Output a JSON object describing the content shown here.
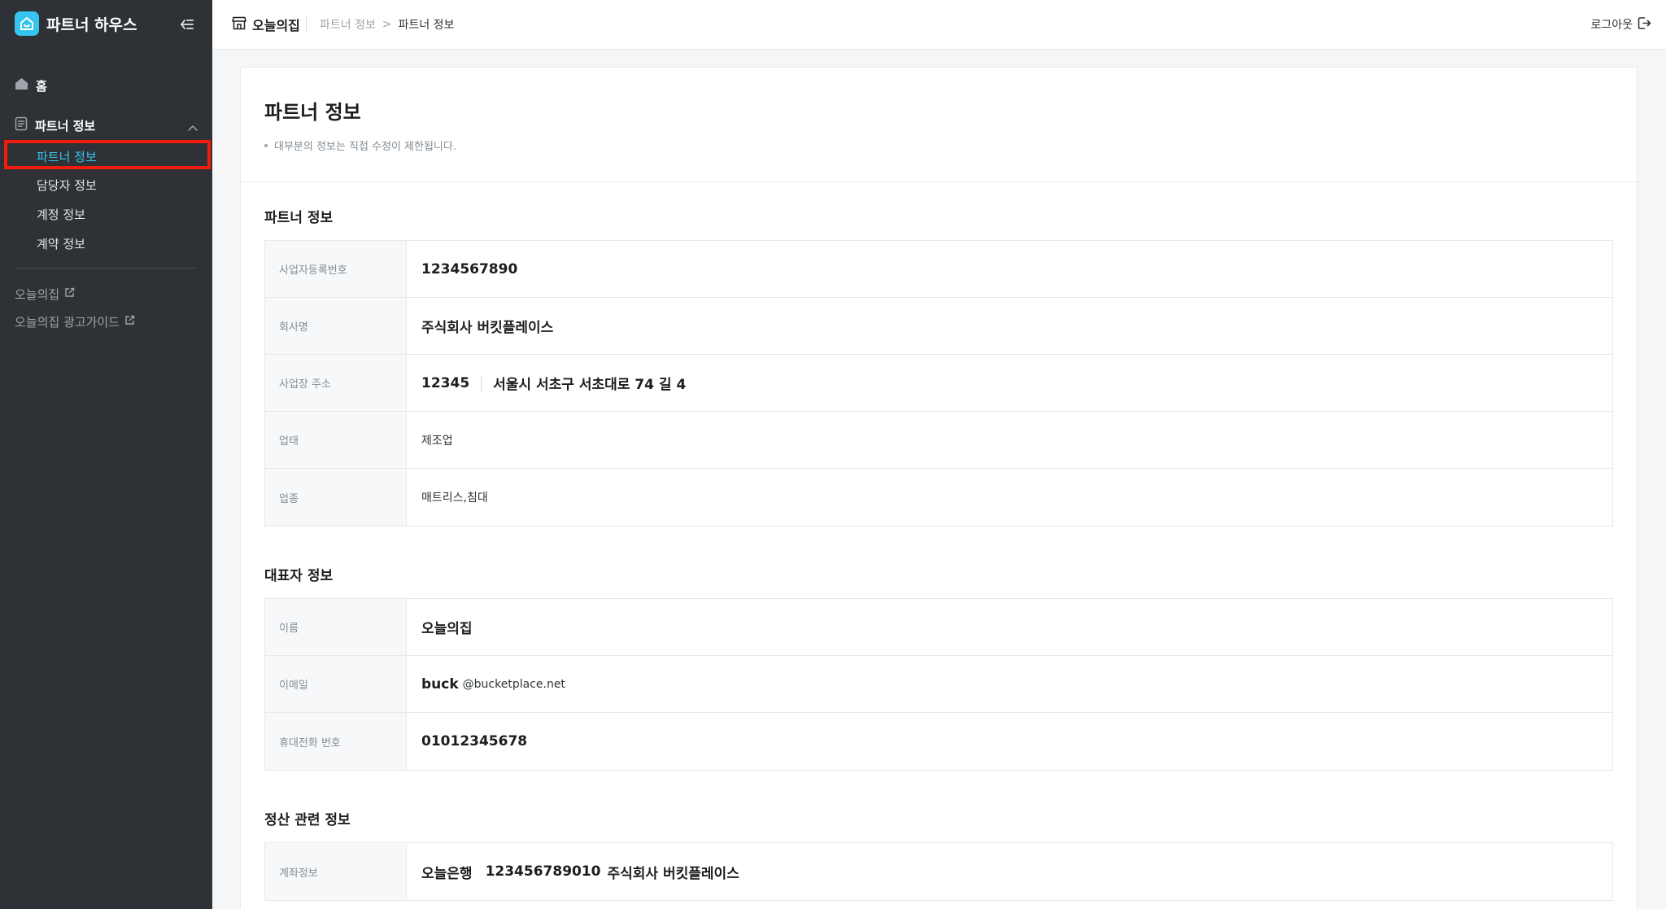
{
  "sidebar": {
    "brand": "파트너 하우스",
    "home": "홈",
    "group": "파트너 정보",
    "items": [
      "파트너 정보",
      "담당자 정보",
      "계정 정보",
      "계약 정보"
    ],
    "links": [
      "오늘의집",
      "오늘의집 광고가이드"
    ]
  },
  "topbar": {
    "shop": "오늘의집",
    "breadcrumb": [
      "파트너 정보",
      "파트너 정보"
    ],
    "logout": "로그아웃"
  },
  "page": {
    "title": "파트너 정보",
    "note": "대부분의 정보는 직접 수정이 제한됩니다."
  },
  "partner": {
    "title": "파트너 정보",
    "labels": [
      "사업자등록번호",
      "회사명",
      "사업장 주소",
      "업태",
      "업종"
    ],
    "business_number": "1234567890",
    "company": "주식회사 버킷플레이스",
    "zip": "12345",
    "address": "서울시 서초구 서초대로 74 길 4",
    "business_type": "제조업",
    "business_item": "매트리스,침대"
  },
  "representative": {
    "title": "대표자 정보",
    "labels": [
      "이름",
      "이메일",
      "휴대전화 번호"
    ],
    "name": "오늘의집",
    "email_id": "buck",
    "email_domain": "@bucketplace.net",
    "phone": "01012345678"
  },
  "settlement": {
    "title": "정산 관련 정보",
    "labels": [
      "계좌정보"
    ],
    "bank": "오늘은행",
    "account": "123456789010",
    "owner": "주식회사 버킷플레이스"
  },
  "colors": {
    "sidebar_bg": "#2e3236",
    "accent": "#35c5f0",
    "highlight": "#f11c0c"
  }
}
